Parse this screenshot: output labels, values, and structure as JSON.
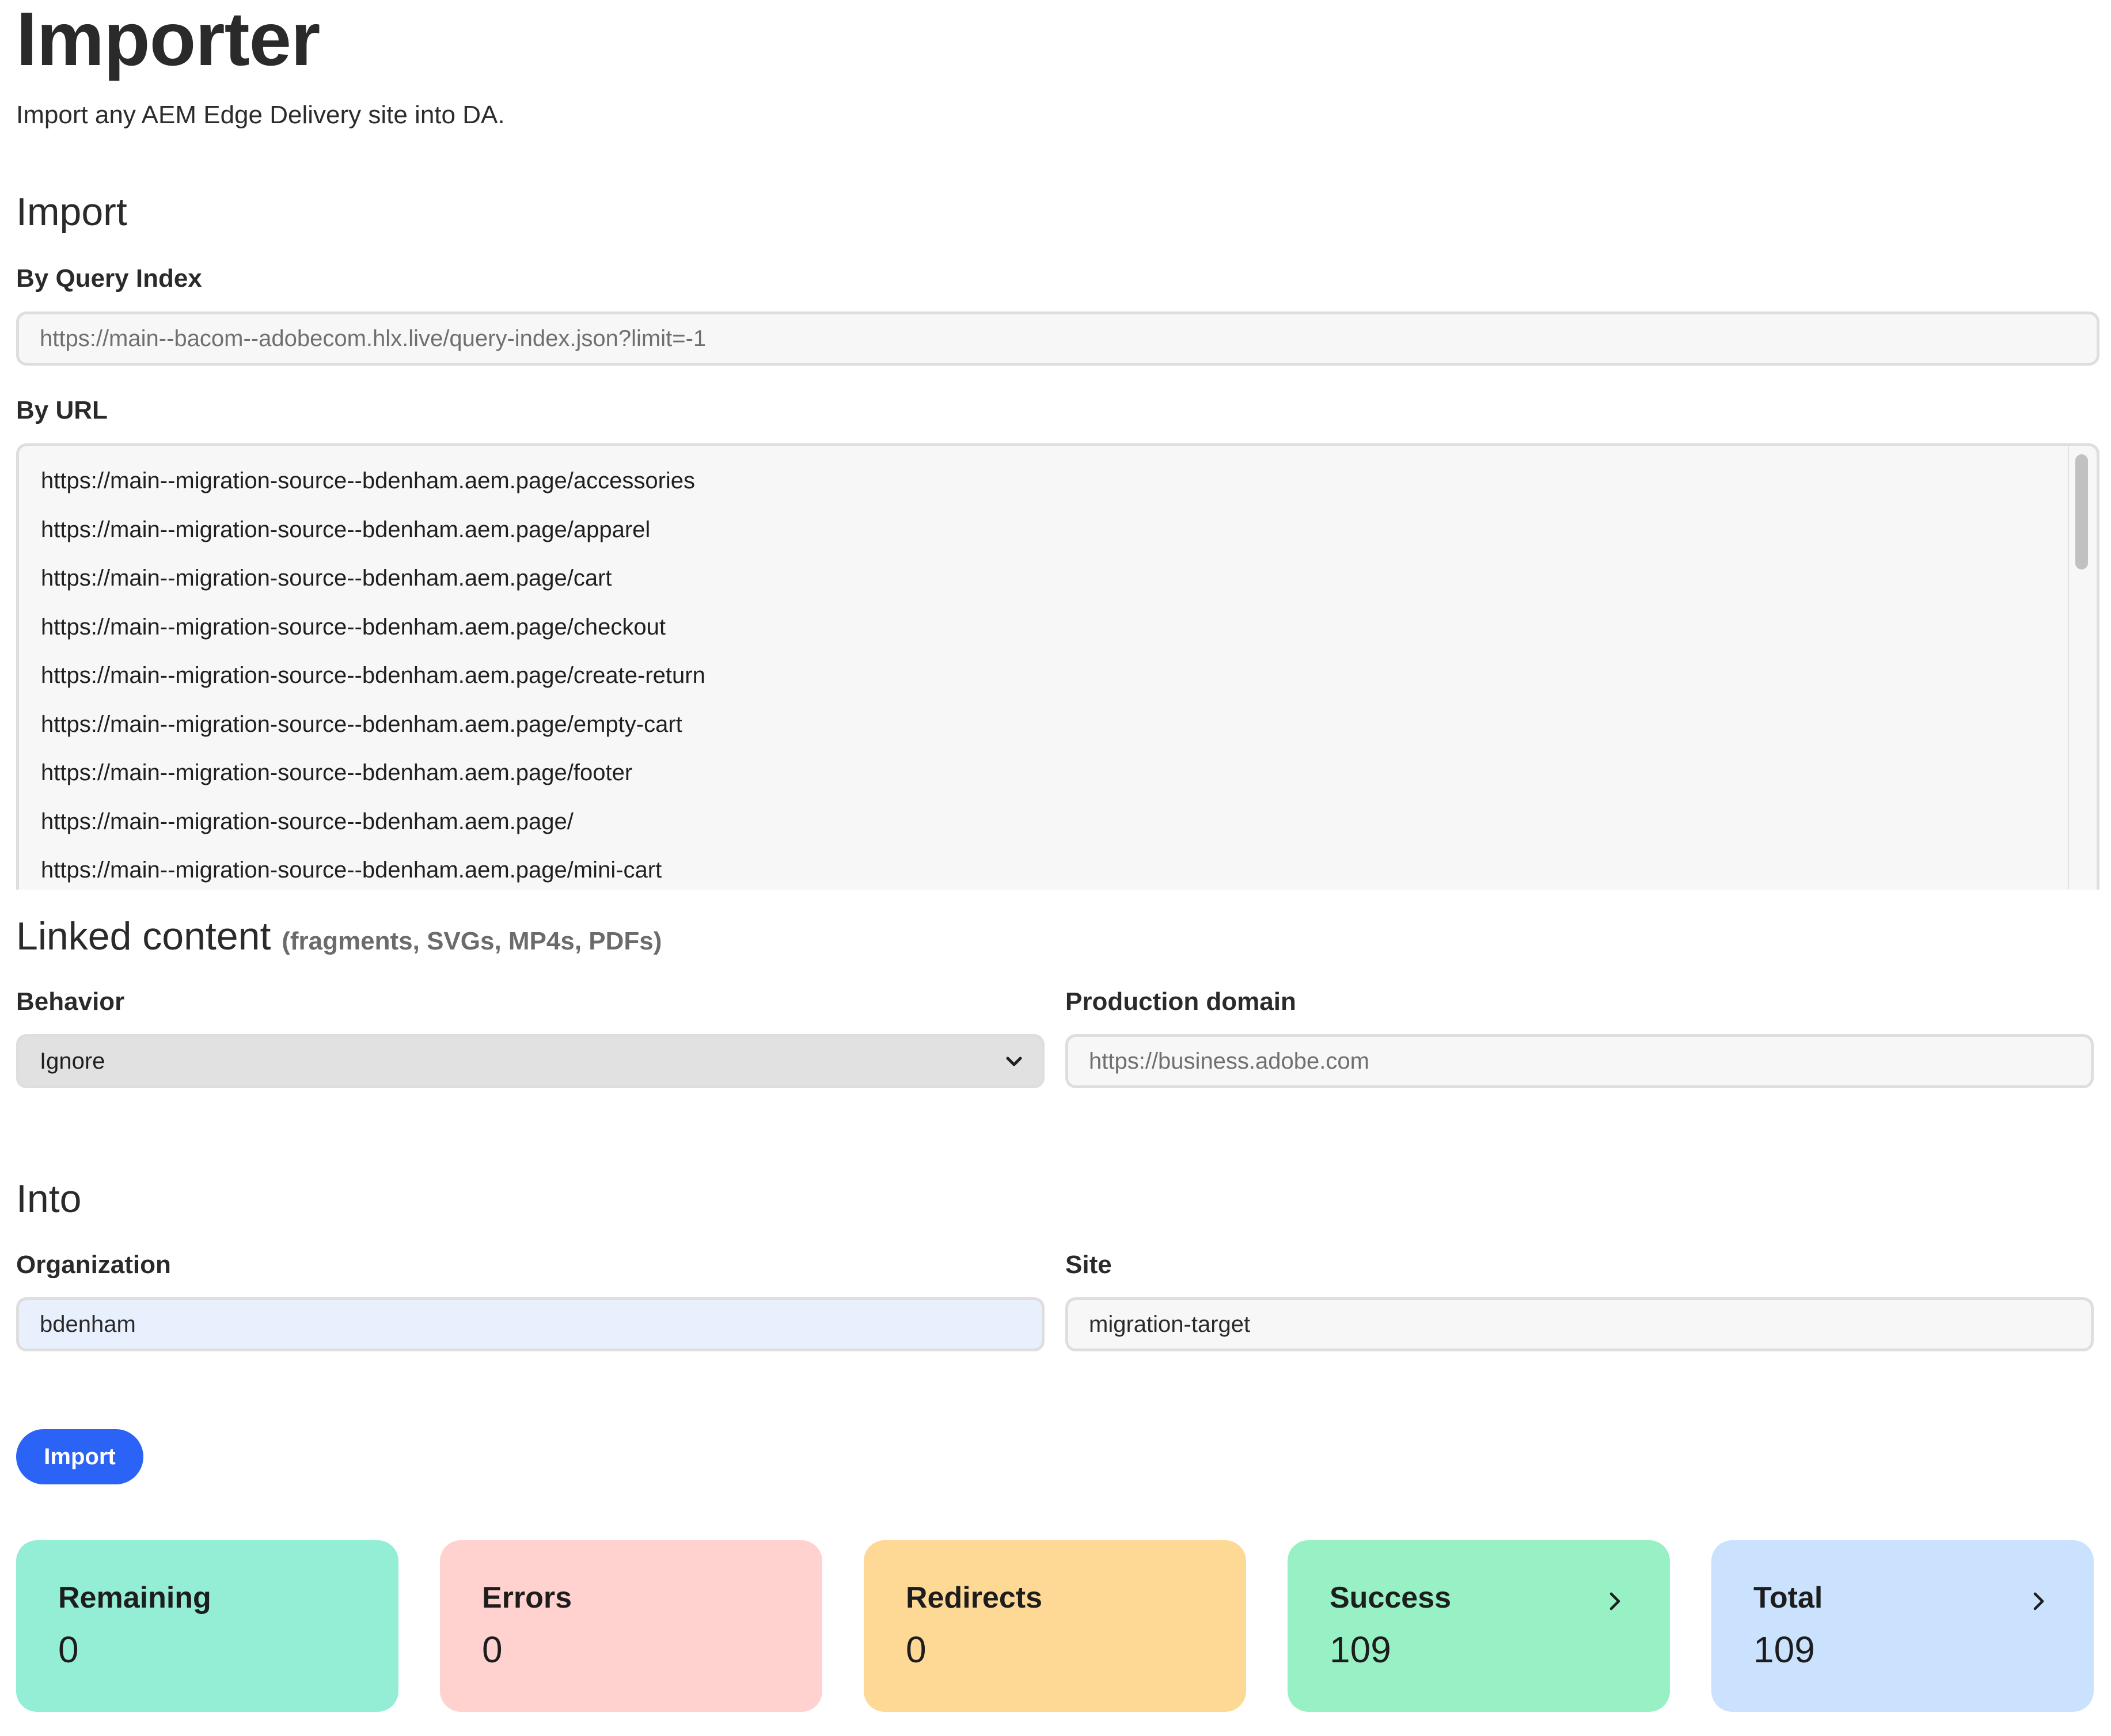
{
  "header": {
    "title": "Importer",
    "subtitle": "Import any AEM Edge Delivery site into DA."
  },
  "import_section": {
    "title": "Import",
    "query_index": {
      "label": "By Query Index",
      "placeholder": "https://main--bacom--adobecom.hlx.live/query-index.json?limit=-1",
      "value": ""
    },
    "by_url": {
      "label": "By URL",
      "urls": [
        "https://main--migration-source--bdenham.aem.page/accessories",
        "https://main--migration-source--bdenham.aem.page/apparel",
        "https://main--migration-source--bdenham.aem.page/cart",
        "https://main--migration-source--bdenham.aem.page/checkout",
        "https://main--migration-source--bdenham.aem.page/create-return",
        "https://main--migration-source--bdenham.aem.page/empty-cart",
        "https://main--migration-source--bdenham.aem.page/footer",
        "https://main--migration-source--bdenham.aem.page/",
        "https://main--migration-source--bdenham.aem.page/mini-cart"
      ]
    }
  },
  "linked_content": {
    "title": "Linked content",
    "note": "(fragments, SVGs, MP4s, PDFs)",
    "behavior": {
      "label": "Behavior",
      "selected": "Ignore",
      "icon": "chevron-down-icon"
    },
    "production_domain": {
      "label": "Production domain",
      "placeholder": "https://business.adobe.com",
      "value": ""
    }
  },
  "into": {
    "title": "Into",
    "organization": {
      "label": "Organization",
      "value": "bdenham"
    },
    "site": {
      "label": "Site",
      "value": "migration-target"
    }
  },
  "actions": {
    "import_label": "Import",
    "import_color": "#2a63f6"
  },
  "stats": [
    {
      "label": "Remaining",
      "value": "0",
      "color": "#94eed6",
      "has_chevron": false
    },
    {
      "label": "Errors",
      "value": "0",
      "color": "#ffd2cf",
      "has_chevron": false
    },
    {
      "label": "Redirects",
      "value": "0",
      "color": "#fed996",
      "has_chevron": false
    },
    {
      "label": "Success",
      "value": "109",
      "color": "#98f0c5",
      "has_chevron": true,
      "icon": "chevron-right-icon"
    },
    {
      "label": "Total",
      "value": "109",
      "color": "#cbe2fe",
      "has_chevron": true,
      "icon": "chevron-right-icon"
    }
  ]
}
